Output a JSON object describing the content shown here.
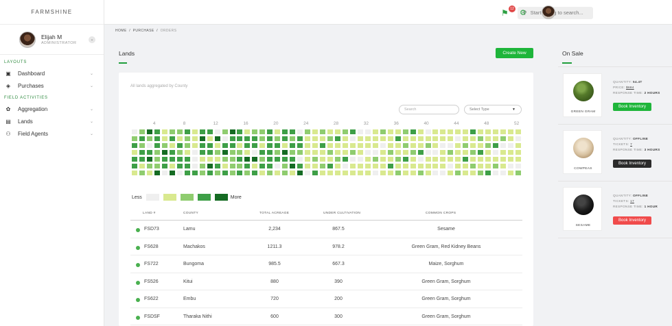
{
  "brand": "FARMSHINE",
  "user": {
    "name": "Elijah M",
    "role": "ADMINISTRATOR"
  },
  "sidebar": {
    "sections": [
      {
        "label": "LAYOUTS",
        "items": [
          {
            "label": "Dashboard",
            "icon": "dashboard-icon"
          },
          {
            "label": "Purchases",
            "icon": "layers-icon"
          }
        ]
      },
      {
        "label": "FIELD ACTIVITIES",
        "items": [
          {
            "label": "Aggregation",
            "icon": "sprout-icon"
          },
          {
            "label": "Lands",
            "icon": "document-icon"
          },
          {
            "label": "Field Agents",
            "icon": "agents-icon"
          }
        ]
      }
    ]
  },
  "topbar": {
    "search_placeholder": "Start typing to search...",
    "notification_count": "12"
  },
  "breadcrumb": {
    "home": "HOME",
    "sep": "/",
    "purchase": "PURCHASE",
    "current": "ORDERS"
  },
  "lands": {
    "title": "Lands",
    "create_label": "Create New",
    "subtitle": "All lands aggregated by County",
    "search_placeholder": "Search",
    "select_label": "Select Type",
    "week_labels": [
      "4",
      "8",
      "12",
      "16",
      "20",
      "24",
      "28",
      "32",
      "36",
      "40",
      "44",
      "48",
      "52"
    ],
    "legend": {
      "less": "Less",
      "more": "More"
    },
    "colors": [
      "#efefef",
      "#d9e98f",
      "#8fcc6f",
      "#3e9f47",
      "#156b23"
    ],
    "columns": [
      "LAND #",
      "COUNTY",
      "TOTAL ACREAGE",
      "UNDER CULTIVATION",
      "COMMON CROPS"
    ],
    "rows": [
      {
        "land": "FSD73",
        "county": "Lamu",
        "acreage": "2,234",
        "cultivation": "867.5",
        "crops": "Sesame"
      },
      {
        "land": "FS628",
        "county": "Machakos",
        "acreage": "1211.3",
        "cultivation": "978.2",
        "crops": "Green Gram, Red Kidney Beans"
      },
      {
        "land": "FS722",
        "county": "Bungoma",
        "acreage": "985.5",
        "cultivation": "667.3",
        "crops": "Maize, Sorghum"
      },
      {
        "land": "FS526",
        "county": "Kitui",
        "acreage": "880",
        "cultivation": "390",
        "crops": "Green Gram, Sorghum"
      },
      {
        "land": "FS622",
        "county": "Embu",
        "acreage": "720",
        "cultivation": "200",
        "crops": "Green Gram, Sorghum"
      },
      {
        "land": "FSDSF",
        "county": "Tharaka Nithi",
        "acreage": "600",
        "cultivation": "300",
        "crops": "Green Gram, Sorghum"
      }
    ]
  },
  "on_sale": {
    "title": "On Sale",
    "products": [
      {
        "name": "GREEN GRAM",
        "line1_label": "QUANTITY:",
        "line1_value": "54.4T",
        "line2_label": "PRICE:",
        "line2_value": "$684",
        "line3_label": "RESPONSE TIME:",
        "line3_value": "2 HOURS",
        "button": "Book Inventory",
        "button_color": "#1eb53a",
        "image": "green-gram-icon"
      },
      {
        "name": "COWPEAS",
        "line1_label": "QUANTITY:",
        "line1_value": "OFFLINE",
        "line2_label": "TICKETS:",
        "line2_value": "7",
        "line3_label": "RESPONSE TIME:",
        "line3_value": "3 HOURS",
        "button": "Book Inventory",
        "button_color": "#2b2b2b",
        "image": "cowpeas-icon"
      },
      {
        "name": "SESAME",
        "line1_label": "QUANTITY:",
        "line1_value": "OFFLINE",
        "line2_label": "TICKETS:",
        "line2_value": "17",
        "line3_label": "RESPONSE TIME:",
        "line3_value": "1 HOUR",
        "button": "Book Inventory",
        "button_color": "#f04b4b",
        "image": "sesame-icon"
      }
    ]
  }
}
